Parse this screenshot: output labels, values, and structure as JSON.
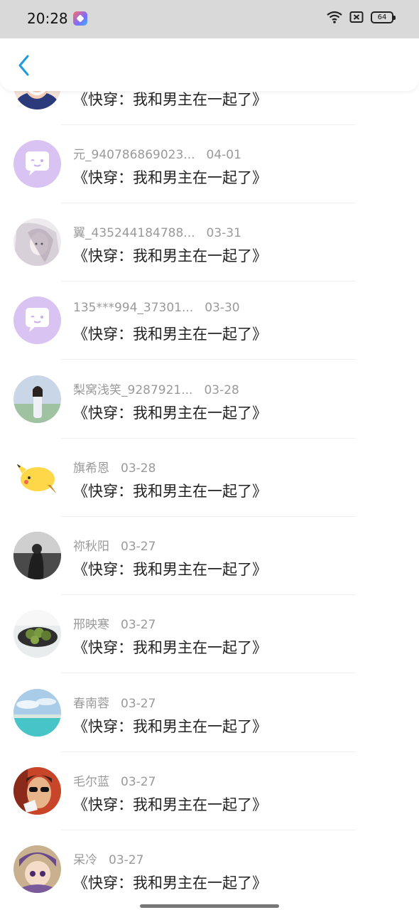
{
  "status_bar": {
    "time": "20:28",
    "battery": "64"
  },
  "header": {
    "back_icon": "chevron-left-icon",
    "accent_color": "#1e9be0"
  },
  "comments": [
    {
      "user": "",
      "date": "",
      "book": "《快穿：我和男主在一起了》",
      "avatar": "smiling-girl"
    },
    {
      "user": "元_940786869023...",
      "date": "04-01",
      "book": "《快穿：我和男主在一起了》",
      "avatar": "default-chat-bubble"
    },
    {
      "user": "翼_435244184788...",
      "date": "03-31",
      "book": "《快穿：我和男主在一起了》",
      "avatar": "sketch-girl"
    },
    {
      "user": "135***994_37301...",
      "date": "03-30",
      "book": "《快穿：我和男主在一起了》",
      "avatar": "default-chat-bubble"
    },
    {
      "user": "梨窝浅笑_9287921...",
      "date": "03-28",
      "book": "《快穿：我和男主在一起了》",
      "avatar": "girl-in-park"
    },
    {
      "user": "旗希恩",
      "date": "03-28",
      "book": "《快穿：我和男主在一起了》",
      "avatar": "yellow-cartoon"
    },
    {
      "user": "祢秋阳",
      "date": "03-27",
      "book": "《快穿：我和男主在一起了》",
      "avatar": "grey-sea"
    },
    {
      "user": "邢映寒",
      "date": "03-27",
      "book": "《快穿：我和男主在一起了》",
      "avatar": "fruit-bowl"
    },
    {
      "user": "春南蓉",
      "date": "03-27",
      "book": "《快穿：我和男主在一起了》",
      "avatar": "beach"
    },
    {
      "user": "毛尔蓝",
      "date": "03-27",
      "book": "《快穿：我和男主在一起了》",
      "avatar": "sunglasses-person"
    },
    {
      "user": "呆冷",
      "date": "03-27",
      "book": "《快穿：我和男主在一起了》",
      "avatar": "anime-character"
    }
  ]
}
